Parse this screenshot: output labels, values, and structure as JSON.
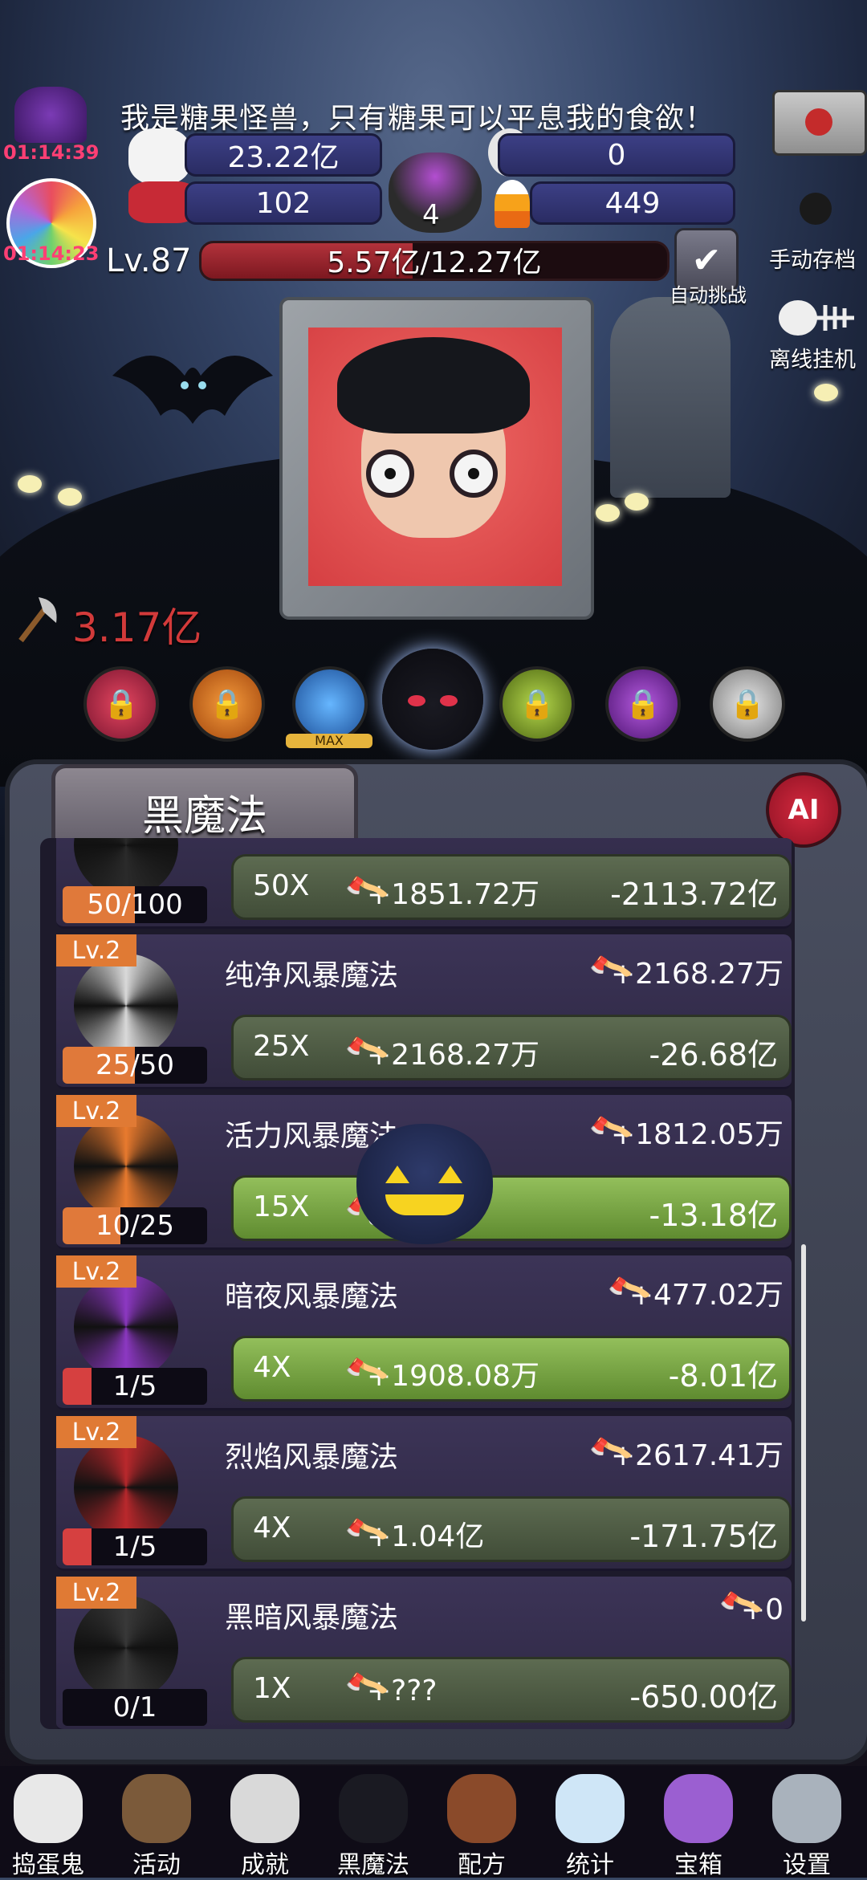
{
  "quote": "我是糖果怪兽，只有糖果可以平息我的食欲！",
  "timers": {
    "t1": "01:14:39",
    "t2": "01:14:23"
  },
  "resources": {
    "candy": "23.22亿",
    "skull": "0",
    "wrapped_candy": "102",
    "cauldron": "4",
    "corn": "449"
  },
  "level": {
    "label": "Lv.87",
    "hp": "5.57亿/12.27亿",
    "hp_fraction": 0.454
  },
  "side": {
    "auto_challenge": "自动挑战",
    "manual_save": "手动存档",
    "offline": "离线挂机"
  },
  "damage": "3.17亿",
  "orbs": {
    "max_label": "MAX"
  },
  "panel": {
    "title": "黑魔法",
    "ai": "AI"
  },
  "spells": [
    {
      "level": "",
      "name": "",
      "dps": "",
      "count": "50/100",
      "fill": 0.5,
      "color": "#e0793a",
      "mult": "50X",
      "gain": "+1851.72万",
      "cost": "-2113.72亿",
      "active": false,
      "spiral": "#2a2a2a"
    },
    {
      "level": "Lv.2",
      "name": "纯净风暴魔法",
      "dps": "+2168.27万",
      "count": "25/50",
      "fill": 0.5,
      "color": "#e0793a",
      "mult": "25X",
      "gain": "+2168.27万",
      "cost": "-26.68亿",
      "active": false,
      "spiral": "#d9d9d9"
    },
    {
      "level": "Lv.2",
      "name": "活力风暴魔法",
      "dps": "+1812.05万",
      "count": "10/25",
      "fill": 0.4,
      "color": "#e0793a",
      "mult": "15X",
      "gain": "8万",
      "cost": "-13.18亿",
      "active": true,
      "spiral": "#e87a2e"
    },
    {
      "level": "Lv.2",
      "name": "暗夜风暴魔法",
      "dps": "+477.02万",
      "count": "1/5",
      "fill": 0.2,
      "color": "#d64040",
      "mult": "4X",
      "gain": "+1908.08万",
      "cost": "-8.01亿",
      "active": true,
      "spiral": "#8c38c2"
    },
    {
      "level": "Lv.2",
      "name": "烈焰风暴魔法",
      "dps": "+2617.41万",
      "count": "1/5",
      "fill": 0.2,
      "color": "#d64040",
      "mult": "4X",
      "gain": "+1.04亿",
      "cost": "-171.75亿",
      "active": false,
      "spiral": "#b9282c"
    },
    {
      "level": "Lv.2",
      "name": "黑暗风暴魔法",
      "dps": "+0",
      "count": "0/1",
      "fill": 0,
      "color": "#d64040",
      "mult": "1X",
      "gain": "+???",
      "cost": "-650.00亿",
      "active": false,
      "spiral": "#383838"
    }
  ],
  "nav": [
    "捣蛋鬼",
    "活动",
    "成就",
    "黑魔法",
    "配方",
    "统计",
    "宝箱",
    "设置"
  ]
}
